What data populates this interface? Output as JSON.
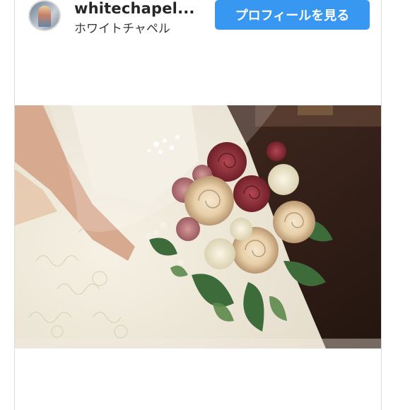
{
  "account": {
    "username": "whitechapel...",
    "display_name": "ホワイトチャペル",
    "avatar_icon": "chapel-window-avatar-icon"
  },
  "actions": {
    "profile_button_label": "プロフィールを見る",
    "profile_button_color": "#3897f0"
  },
  "post": {
    "image_icon": "wedding-bouquet-photo"
  }
}
